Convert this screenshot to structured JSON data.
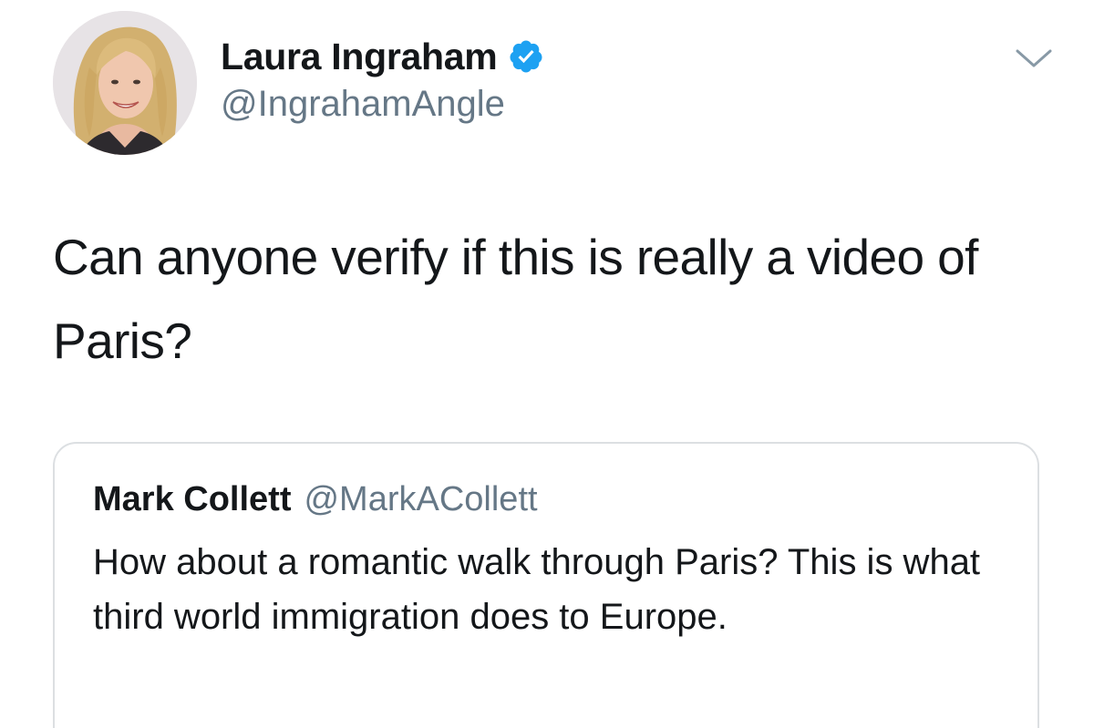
{
  "author": {
    "display_name": "Laura Ingraham",
    "handle": "@IngrahamAngle",
    "verified": true,
    "avatar_icon": "profile-photo"
  },
  "tweet": {
    "text": "Can anyone verify if this is really a video of Paris?"
  },
  "menu": {
    "icon": "chevron-down-icon"
  },
  "quoted_tweet": {
    "display_name": "Mark Collett",
    "handle": "@MarkACollett",
    "text": "How about a romantic walk through Paris? This is what third world immigration does to Europe."
  },
  "colors": {
    "text_primary": "#14171a",
    "text_secondary": "#657786",
    "verified_blue": "#1da1f2",
    "card_border": "#dcdfe2"
  }
}
